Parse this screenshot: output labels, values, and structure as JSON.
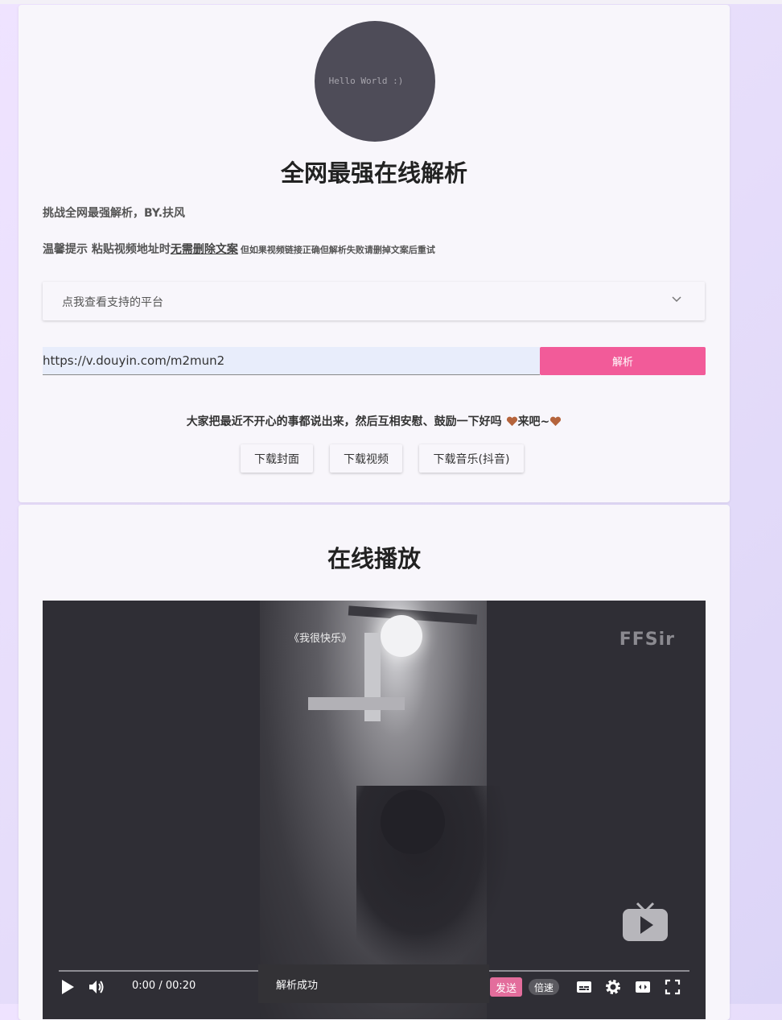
{
  "header": {
    "avatar_text": "Hello World :)",
    "title": "全网最强在线解析",
    "subtitle": "挑战全网最强解析，BY.扶风",
    "tip_prefix": "温馨提示 粘贴视频地址时",
    "tip_emphasis": "无需删除文案",
    "tip_suffix": "但如果视频链接正确但解析失败请删掉文案后重试"
  },
  "platforms_dropdown": {
    "label": "点我查看支持的平台",
    "icon": "chevron-down-icon"
  },
  "url_input": {
    "value": "https://v.douyin.com/m2mun2"
  },
  "parse_button": {
    "label": "解析",
    "color": "#f25b99"
  },
  "message": {
    "text_1": "大家把最近不开心的事都说出来，然后互相安慰、鼓励一下好吗",
    "text_2": "来吧~",
    "icon": "heart-icon"
  },
  "download_buttons": [
    {
      "label": "下载封面"
    },
    {
      "label": "下载视频"
    },
    {
      "label": "下载音乐(抖音)"
    }
  ],
  "player_section": {
    "title": "在线播放",
    "video_caption": "《我很快乐》",
    "watermark": "FFSir",
    "time": "0:00 / 00:20",
    "send_label": "发送",
    "speed_label": "倍速",
    "toast": "解析成功"
  }
}
